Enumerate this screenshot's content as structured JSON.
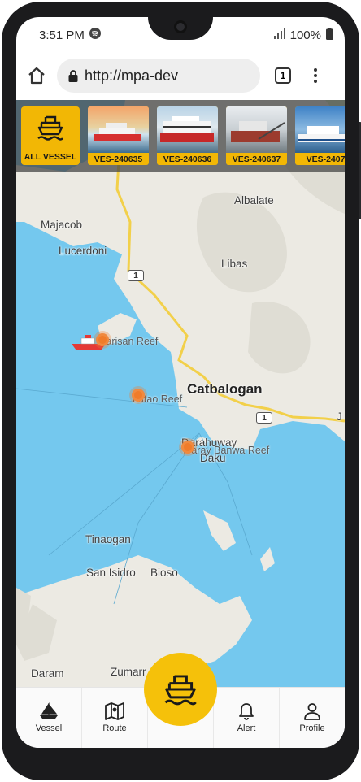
{
  "status_bar": {
    "time": "3:51 PM",
    "battery": "100%"
  },
  "browser": {
    "url": "http://mpa-dev",
    "tab_count": "1"
  },
  "vessel_strip": {
    "all_label": "ALL VESSEL",
    "vessels": [
      {
        "id": "VES-240635"
      },
      {
        "id": "VES-240636"
      },
      {
        "id": "VES-240637"
      },
      {
        "id": "VES-2407"
      }
    ]
  },
  "map": {
    "labels": {
      "albalate": "Albalate",
      "majacob": "Majacob",
      "lucerdoni": "Lucerdoni",
      "libas": "Libas",
      "marisan_reef": "Marisan Reef",
      "lutao_reef": "Lutao Reef",
      "catbalogan": "Catbalogan",
      "darahuway": "Darahuway",
      "waray_banwa_reef": "Waray Banwa Reef",
      "daku": "Daku",
      "tinaogan": "Tinaogan",
      "san_isidro": "San Isidro",
      "bioso": "Bioso",
      "zumarraga": "Zumarr",
      "daram": "Daram",
      "j_edge": "J"
    },
    "road_shields": [
      "1",
      "1"
    ],
    "colors": {
      "water": "#74c8ee",
      "land": "#eceae3",
      "road": "#f2d04a",
      "marker": "#f07c2a"
    }
  },
  "bottom_nav": {
    "items": [
      {
        "label": "Vessel",
        "icon": "sailboat-icon"
      },
      {
        "label": "Route",
        "icon": "map-route-icon"
      },
      {
        "label": "",
        "icon": "ship-icon"
      },
      {
        "label": "Alert",
        "icon": "bell-icon"
      },
      {
        "label": "Profile",
        "icon": "person-icon"
      }
    ]
  },
  "accent_color": "#f2b705"
}
